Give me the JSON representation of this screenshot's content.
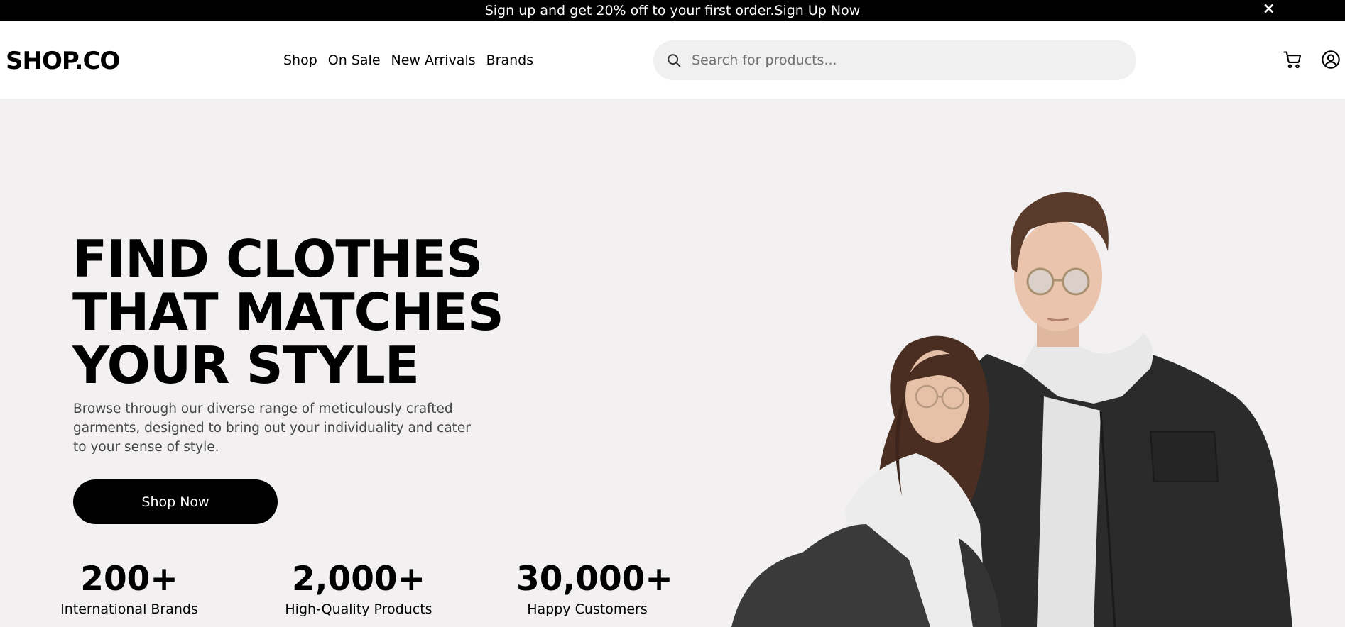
{
  "promo": {
    "text": "Sign up and get 20% off to your first order.",
    "link": "Sign Up Now",
    "close": "×"
  },
  "header": {
    "logo": "SHOP.CO",
    "nav": [
      "Shop",
      "On Sale",
      "New Arrivals",
      "Brands"
    ],
    "search_placeholder": "Search for products...",
    "icons": [
      "search-icon",
      "cart-icon",
      "user-icon"
    ]
  },
  "hero": {
    "headline": "FIND CLOTHES\nTHAT MATCHES\nYOUR STYLE",
    "description": "Browse through our diverse range of meticulously crafted garments, designed to bring out your individuality and cater to your sense of style.",
    "cta": "Shop Now",
    "stats": [
      {
        "value": "200+",
        "label": "International Brands"
      },
      {
        "value": "2,000+",
        "label": "High-Quality Products"
      },
      {
        "value": "30,000+",
        "label": "Happy Customers"
      }
    ]
  },
  "colors": {
    "promo_bg": "#000000",
    "hero_bg": "#f2f0f1",
    "button_bg": "#000000",
    "search_bg": "#f0f0f0"
  }
}
